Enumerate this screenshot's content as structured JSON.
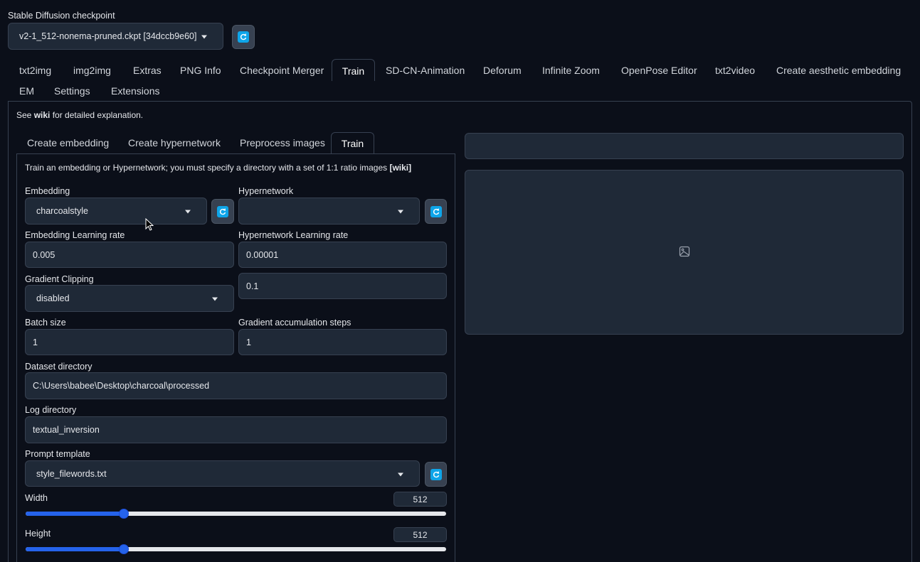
{
  "checkpoint": {
    "label": "Stable Diffusion checkpoint",
    "value": "v2-1_512-nonema-pruned.ckpt [34dccb9e60]"
  },
  "main_tabs": [
    "txt2img",
    "img2img",
    "Extras",
    "PNG Info",
    "Checkpoint Merger",
    "Train",
    "SD-CN-Animation",
    "Deforum",
    "Infinite Zoom",
    "OpenPose Editor",
    "txt2video",
    "Create aesthetic embedding",
    "EM",
    "Settings",
    "Extensions"
  ],
  "active_main_tab": "Train",
  "wiki_note": {
    "prefix": "See ",
    "link": "wiki",
    "suffix": " for detailed explanation."
  },
  "sub_tabs": [
    "Create embedding",
    "Create hypernetwork",
    "Preprocess images",
    "Train"
  ],
  "active_sub_tab": "Train",
  "train": {
    "intro": "Train an embedding or Hypernetwork; you must specify a directory with a set of 1:1 ratio images ",
    "intro_link": "[wiki]",
    "embedding": {
      "label": "Embedding",
      "value": "charcoalstyle"
    },
    "hypernetwork": {
      "label": "Hypernetwork",
      "value": ""
    },
    "embedding_lr": {
      "label": "Embedding Learning rate",
      "value": "0.005"
    },
    "hypernetwork_lr": {
      "label": "Hypernetwork Learning rate",
      "value": "0.00001"
    },
    "gradient_clipping": {
      "label": "Gradient Clipping",
      "value": "disabled",
      "amount": "0.1"
    },
    "batch_size": {
      "label": "Batch size",
      "value": "1"
    },
    "grad_accum": {
      "label": "Gradient accumulation steps",
      "value": "1"
    },
    "dataset_dir": {
      "label": "Dataset directory",
      "value": "C:\\Users\\babee\\Desktop\\charcoal\\processed"
    },
    "log_dir": {
      "label": "Log directory",
      "value": "textual_inversion"
    },
    "prompt_template": {
      "label": "Prompt template",
      "value": "style_filewords.txt"
    },
    "width": {
      "label": "Width",
      "value": "512",
      "fraction": 0.234
    },
    "height": {
      "label": "Height",
      "value": "512",
      "fraction": 0.234
    }
  },
  "icons": {
    "refresh": "refresh-icon",
    "caret": "chevron-down-icon",
    "image_placeholder": "image-icon",
    "cursor": "mouse-cursor"
  },
  "colors": {
    "background": "#0b0f19",
    "field": "#1f2937",
    "border": "#374151",
    "accent": "#2563eb",
    "refresh": "#0ea5e9"
  }
}
